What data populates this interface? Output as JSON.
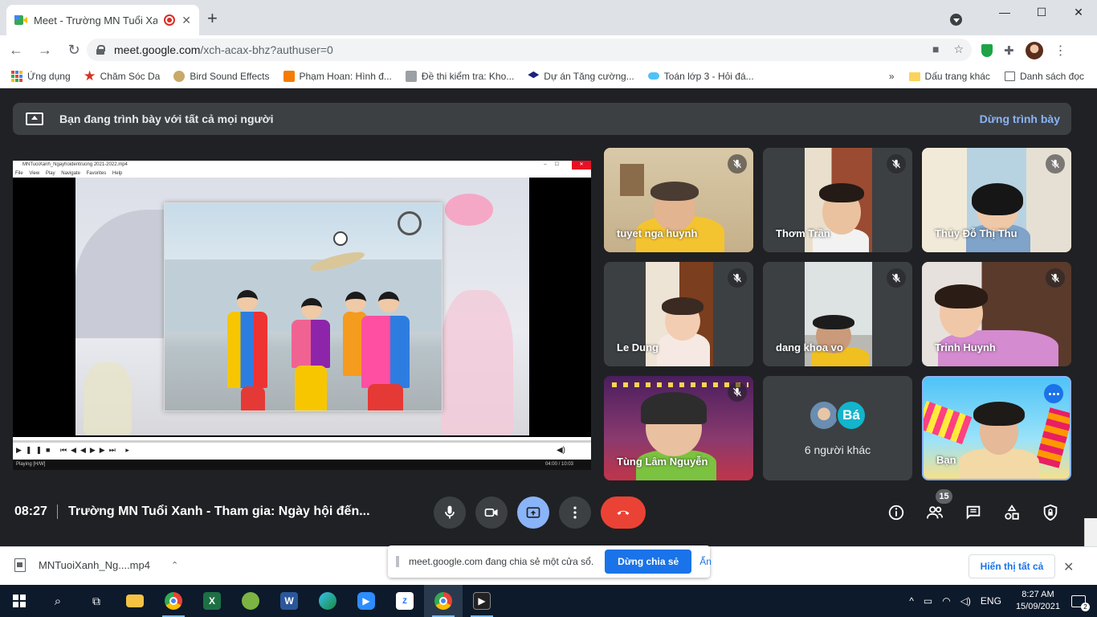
{
  "browser": {
    "tab_title": "Meet - Trường MN Tuổi Xanh",
    "tab_close": "✕",
    "new_tab": "+",
    "url_host": "meet.google.com",
    "url_path": "/xch-acax-bhz?authuser=0",
    "bookmarks": [
      {
        "label": "Ứng dụng",
        "color": "#4285f4"
      },
      {
        "label": "Chăm Sóc Da",
        "color": "#d93025"
      },
      {
        "label": "Bird Sound Effects",
        "color": "#c8a96a"
      },
      {
        "label": "Phạm Hoan: Hình đ...",
        "color": "#f57c00"
      },
      {
        "label": "Đề thi kiểm tra: Kho...",
        "color": "#9aa0a6"
      },
      {
        "label": "Dự án Tăng cường...",
        "color": "#1a237e"
      },
      {
        "label": "Toán lớp 3 - Hỏi đá...",
        "color": "#4fc3f7"
      }
    ],
    "bookmarks_more": "»",
    "other_bookmarks": "Dấu trang khác",
    "reading_list": "Danh sách đọc"
  },
  "meet": {
    "presenting_banner": "Bạn đang trình bày với tất cả mọi người",
    "stop_presenting": "Dừng trình bày",
    "player": {
      "title": "MNTuoiXanh_Ngayhoidentruong 2021-2022.mp4",
      "menu": "File View Play Navigate Favorites Help",
      "status": "Playing [H/W]",
      "time": "04:00 / 10:03"
    },
    "participants": [
      {
        "name": "tuyet nga huynh"
      },
      {
        "name": "Thơm Trần"
      },
      {
        "name": "Thủy Đỗ Thị Thu"
      },
      {
        "name": "Le Dung"
      },
      {
        "name": "dang khoa vo"
      },
      {
        "name": "Trinh Huynh"
      },
      {
        "name": "Tùng Lâm Nguyễn"
      }
    ],
    "others": {
      "initial": "Bá",
      "label": "6 người khác"
    },
    "self_name": "Bạn",
    "clock": "08:27",
    "meeting_title": "Trường MN Tuổi Xanh - Tham gia: Ngày hội đến...",
    "people_count": "15"
  },
  "download": {
    "filename": "MNTuoiXanh_Ng....mp4",
    "share_notice": "meet.google.com đang chia sẻ một cửa sổ.",
    "stop_share": "Dừng chia sẻ",
    "hide": "Ẩn",
    "show_all": "Hiển thị tất cả"
  },
  "taskbar": {
    "language": "ENG",
    "time": "8:27 AM",
    "date": "15/09/2021",
    "notification_count": "2"
  }
}
